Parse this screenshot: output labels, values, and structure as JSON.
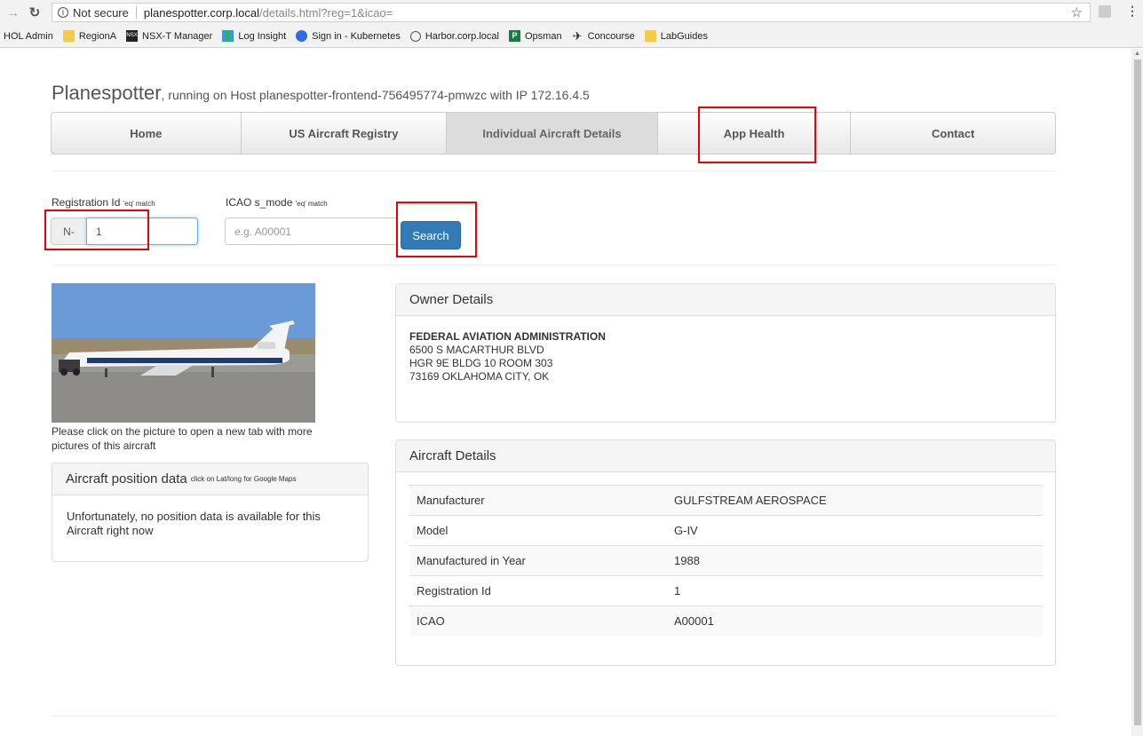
{
  "browser": {
    "secure_label": "Not secure",
    "url_host": "planespotter.corp.local",
    "url_path": "/details.html?reg=1&icao=",
    "bookmarks": [
      {
        "label": "HOL Admin",
        "icon": "none"
      },
      {
        "label": "RegionA",
        "icon": "folder-icon"
      },
      {
        "label": "NSX-T Manager",
        "icon": "nsx-icon"
      },
      {
        "label": "Log Insight",
        "icon": "log-insight-icon"
      },
      {
        "label": "Sign in - Kubernetes",
        "icon": "kubernetes-icon"
      },
      {
        "label": "Harbor.corp.local",
        "icon": "harbor-icon"
      },
      {
        "label": "Opsman",
        "icon": "opsman-icon"
      },
      {
        "label": "Concourse",
        "icon": "plane-icon"
      },
      {
        "label": "LabGuides",
        "icon": "folder-icon"
      }
    ]
  },
  "header": {
    "title": "Planespotter",
    "subtitle": ", running on Host planespotter-frontend-756495774-pmwzc with IP 172.16.4.5"
  },
  "nav": {
    "items": [
      "Home",
      "US Aircraft Registry",
      "Individual Aircraft Details",
      "App Health",
      "Contact"
    ],
    "active_index": 2
  },
  "search": {
    "reg_label": "Registration Id",
    "reg_hint": "'eq' match",
    "reg_prefix": "N-",
    "reg_value": "1",
    "icao_label": "ICAO s_mode",
    "icao_hint": "'eq' match",
    "icao_placeholder": "e.g. A00001",
    "button_label": "Search"
  },
  "photo": {
    "caption": "Please click on the picture to open a new tab with more pictures of this aircraft"
  },
  "position_panel": {
    "title": "Aircraft position data",
    "hint": "click on Lat/long for Google Maps",
    "message": "Unfortunately, no position data is available for this Aircraft right now"
  },
  "owner_panel": {
    "title": "Owner Details",
    "name": "FEDERAL AVIATION ADMINISTRATION",
    "address1": "6500 S MACARTHUR BLVD",
    "address2": "HGR 9E BLDG 10 ROOM 303",
    "address3": "73169 OKLAHOMA CITY, OK"
  },
  "aircraft_panel": {
    "title": "Aircraft Details",
    "rows": [
      {
        "key": "Manufacturer",
        "value": "GULFSTREAM AEROSPACE"
      },
      {
        "key": "Model",
        "value": "G-IV"
      },
      {
        "key": "Manufactured in Year",
        "value": "1988"
      },
      {
        "key": "Registration Id",
        "value": "1"
      },
      {
        "key": "ICAO",
        "value": "A00001"
      }
    ]
  },
  "colors": {
    "primary": "#337ab7",
    "highlight": "#e00000"
  }
}
